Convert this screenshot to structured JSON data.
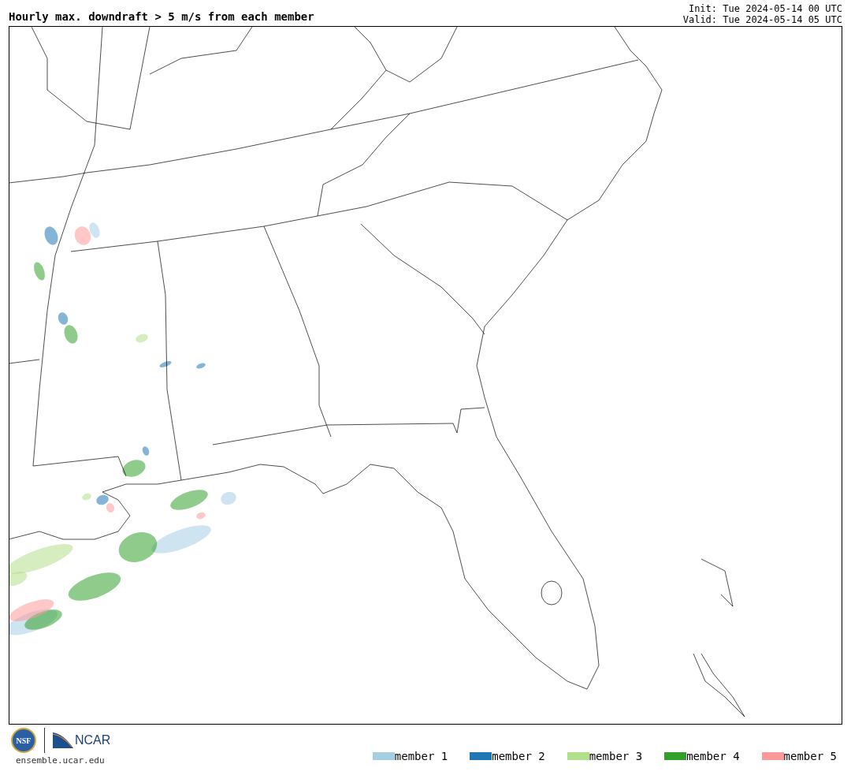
{
  "title": "Hourly max. downdraft > 5 m/s from each member",
  "init": "Init: Tue 2024-05-14 00 UTC",
  "valid": "Valid: Tue 2024-05-14 05 UTC",
  "logos": {
    "nsf": "NSF",
    "ncar": "NCAR"
  },
  "url": "ensemble.ucar.edu",
  "legend": [
    {
      "label": "member 1",
      "color": "#a6cee3"
    },
    {
      "label": "member 2",
      "color": "#1f78b4"
    },
    {
      "label": "member 3",
      "color": "#b2df8a"
    },
    {
      "label": "member 4",
      "color": "#33a02c"
    },
    {
      "label": "member 5",
      "color": "#fb9a99"
    }
  ]
}
